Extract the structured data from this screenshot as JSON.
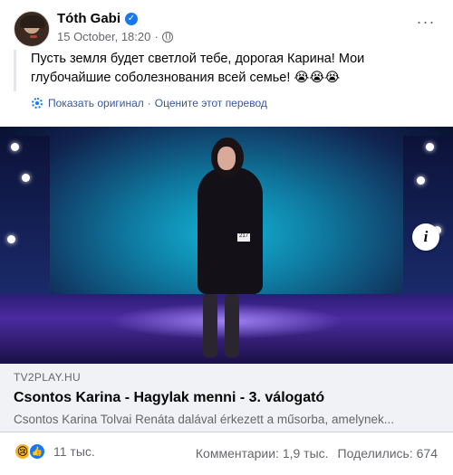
{
  "post": {
    "author": "Tóth Gabi",
    "date": "15 October, 18:20",
    "more_label": "···",
    "text": "Пусть земля будет светлой тебе, дорогая Карина! Мои глубочайшие соболезнования всей семье! 😭😭😭",
    "translation": {
      "see_original": "Показать оригинал",
      "separator": "·",
      "rate": "Оцените этот перевод"
    }
  },
  "image": {
    "badge_number": "217"
  },
  "link_preview": {
    "domain": "TV2PLAY.HU",
    "title": "Csontos Karina - Hagylak menni - 3. válogató",
    "description": "Csontos Karina Tolvai Renáta dalával érkezett a műsorba, amelynek..."
  },
  "footer": {
    "reaction_count": "11 тыс.",
    "comments": "Комментарии: 1,9 тыс.",
    "shares": "Поделились: 674"
  },
  "icons": {
    "verified": "verified-badge-icon",
    "privacy": "globe-icon",
    "translate": "gear-icon",
    "info": "info-icon",
    "sad": "sad-reaction-icon",
    "like": "like-reaction-icon"
  },
  "colors": {
    "accent": "#1877f2",
    "secondary_text": "#65676b",
    "link_card_bg": "#f0f2f5"
  }
}
